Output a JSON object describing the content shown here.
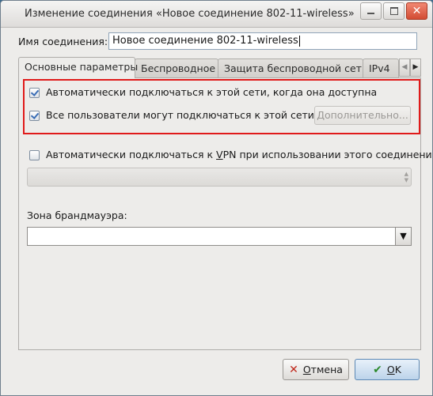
{
  "window": {
    "title": "Изменение соединения «Новое соединение 802-11-wireless»",
    "minimize_icon": "minimize-icon",
    "maximize_icon": "maximize-icon",
    "close_icon": "close-icon",
    "close_glyph": "✕"
  },
  "connection": {
    "name_label": "Имя соединения:",
    "name_value": "Новое соединение 802-11-wireless"
  },
  "tabs": [
    {
      "label": "Основные параметры",
      "active": true
    },
    {
      "label": "Беспроводное"
    },
    {
      "label": "Защита беспроводной сети"
    },
    {
      "label": "IPv4"
    }
  ],
  "tab_scroll": {
    "left_glyph": "◀",
    "right_glyph": "▶"
  },
  "general": {
    "auto_connect": {
      "label": "Автоматически подключаться к этой сети, когда она доступна",
      "checked": true
    },
    "all_users": {
      "label": "Все пользователи могут подключаться к этой сети",
      "checked": true
    },
    "advanced_button": "Дополнительно...",
    "auto_vpn": {
      "label_prefix": "Автоматически подключаться к ",
      "label_mnemonic": "V",
      "label_suffix": "PN при использовании этого соединения",
      "checked": false
    },
    "vpn_select_value": "",
    "firewall_zone_label": "Зона брандмауэра:",
    "firewall_zone_value": "",
    "dropdown_glyph": "▼"
  },
  "buttons": {
    "cancel": {
      "mnemonic": "О",
      "rest": "тмена",
      "icon": "cancel-x-icon"
    },
    "ok": {
      "mnemonic": "O",
      "rest": "K",
      "icon": "ok-check-icon"
    }
  },
  "highlight_color": "#e01a1a"
}
